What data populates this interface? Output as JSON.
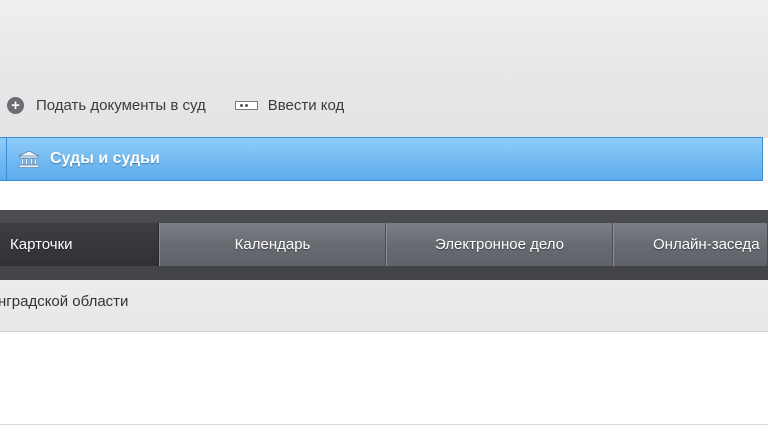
{
  "toolbar": {
    "submit_documents": {
      "label": "Подать документы в суд",
      "icon": "plus-circle-icon"
    },
    "enter_code": {
      "label": "Ввести код",
      "icon": "code-entry-icon"
    }
  },
  "section_bar": {
    "label": "Суды и судьи",
    "icon": "courthouse-icon",
    "color": "#71b9f1"
  },
  "tabs": [
    {
      "label": "Карточки",
      "active": true
    },
    {
      "label": "Календарь",
      "active": false
    },
    {
      "label": "Электронное дело",
      "active": false
    },
    {
      "label": "Онлайн-заседа",
      "active": false
    }
  ],
  "region": {
    "text": "нградской области"
  }
}
